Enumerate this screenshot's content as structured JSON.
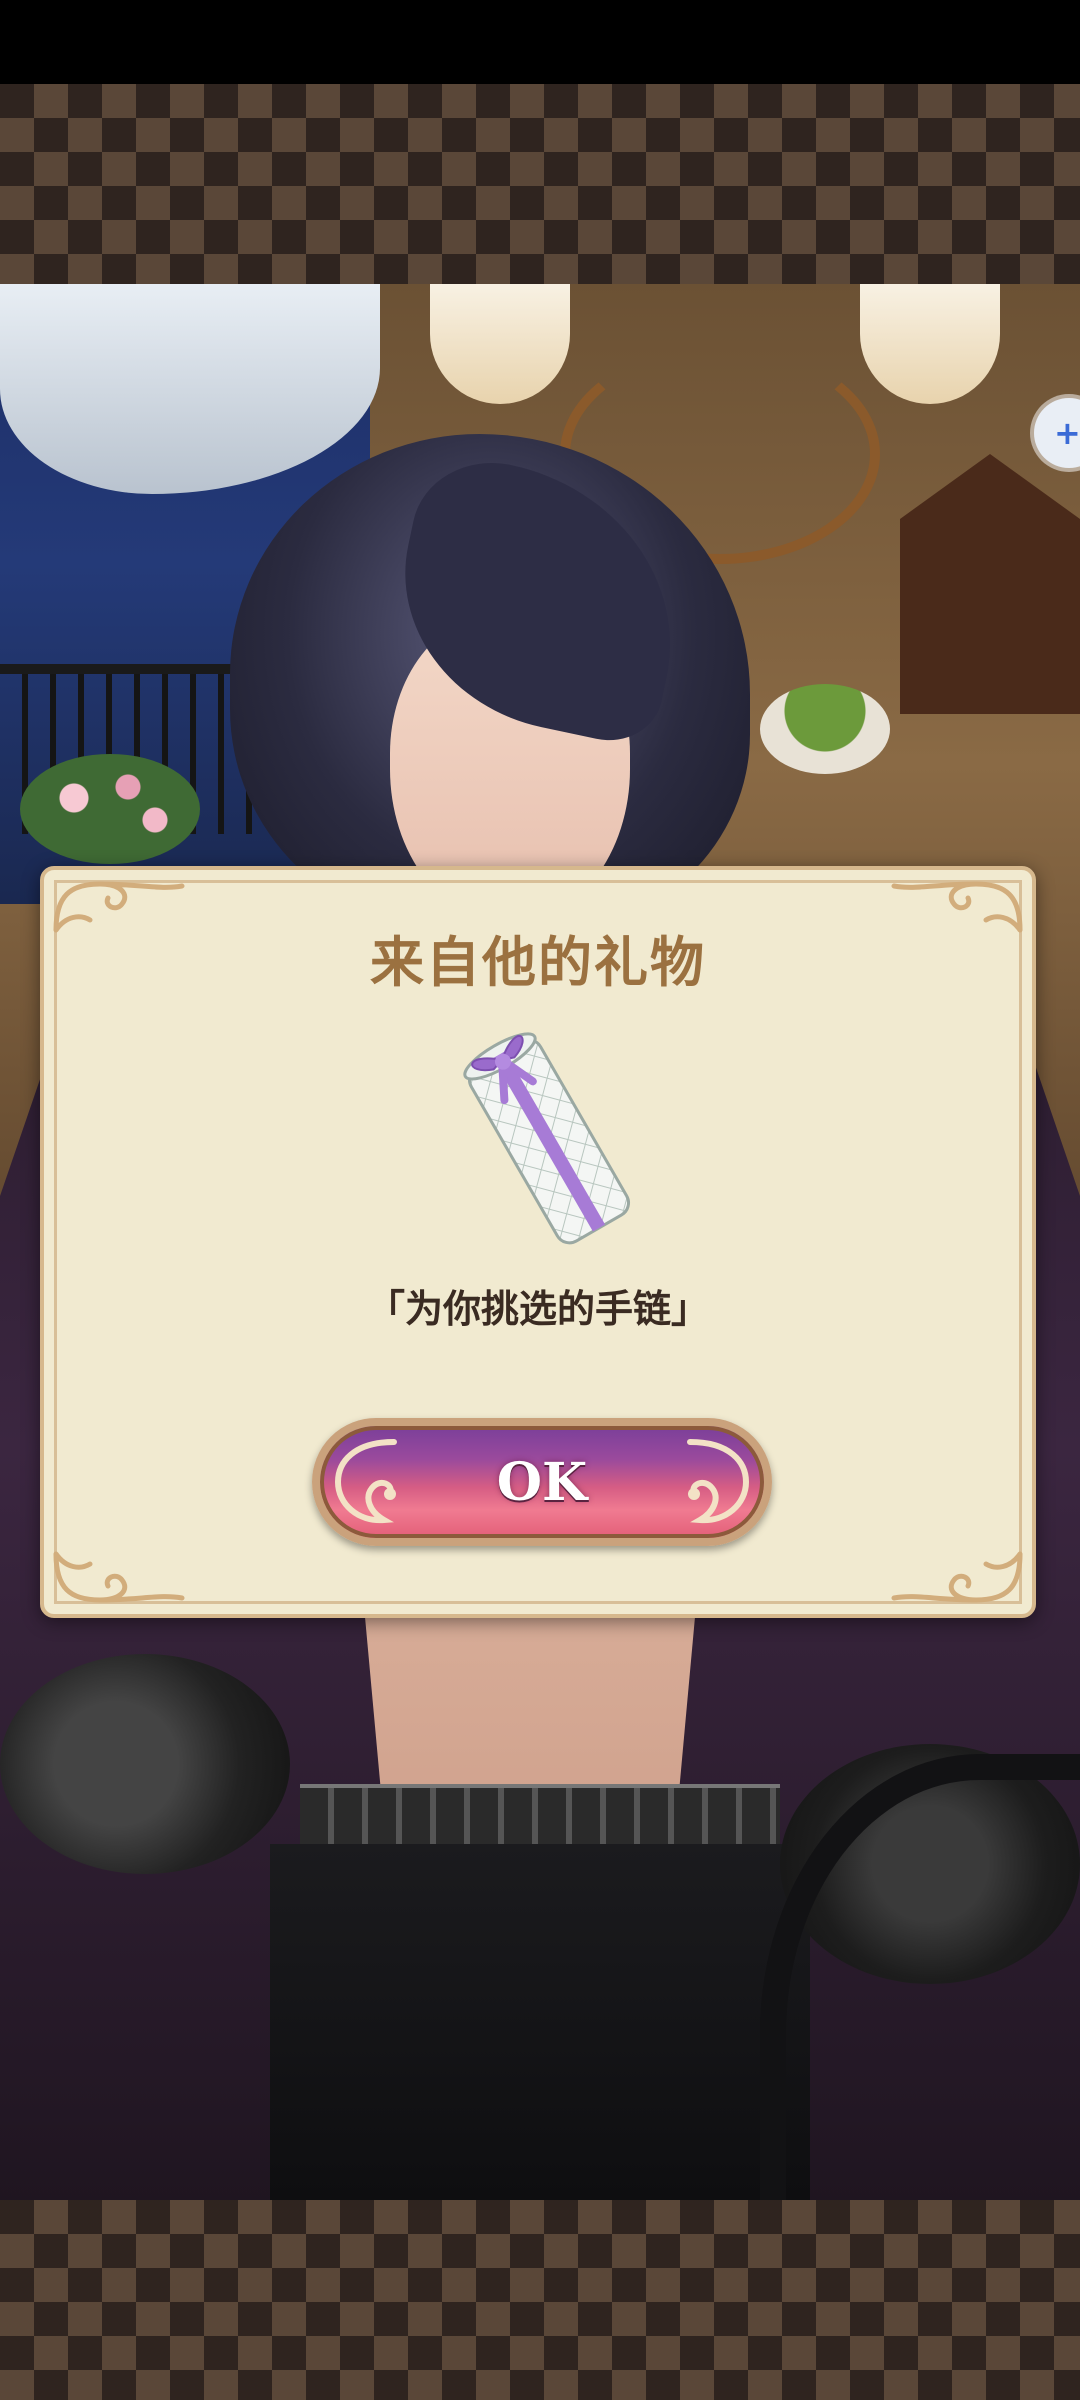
{
  "dialog": {
    "title": "来自他的礼物",
    "gift_name": "「为你挑选的手链」",
    "gift_icon": "wrapped-gift-box-icon",
    "ok_label": "OK"
  },
  "side_button": {
    "icon": "plus-icon"
  },
  "colors": {
    "dialog_bg": "#f1ead0",
    "title": "#9b7140",
    "ribbon": "#a77bd6",
    "ok_button_top": "#7a3f9a",
    "ok_button_bottom": "#e35f78",
    "pattern_light": "#5a4738",
    "pattern_dark": "#2f241f"
  }
}
